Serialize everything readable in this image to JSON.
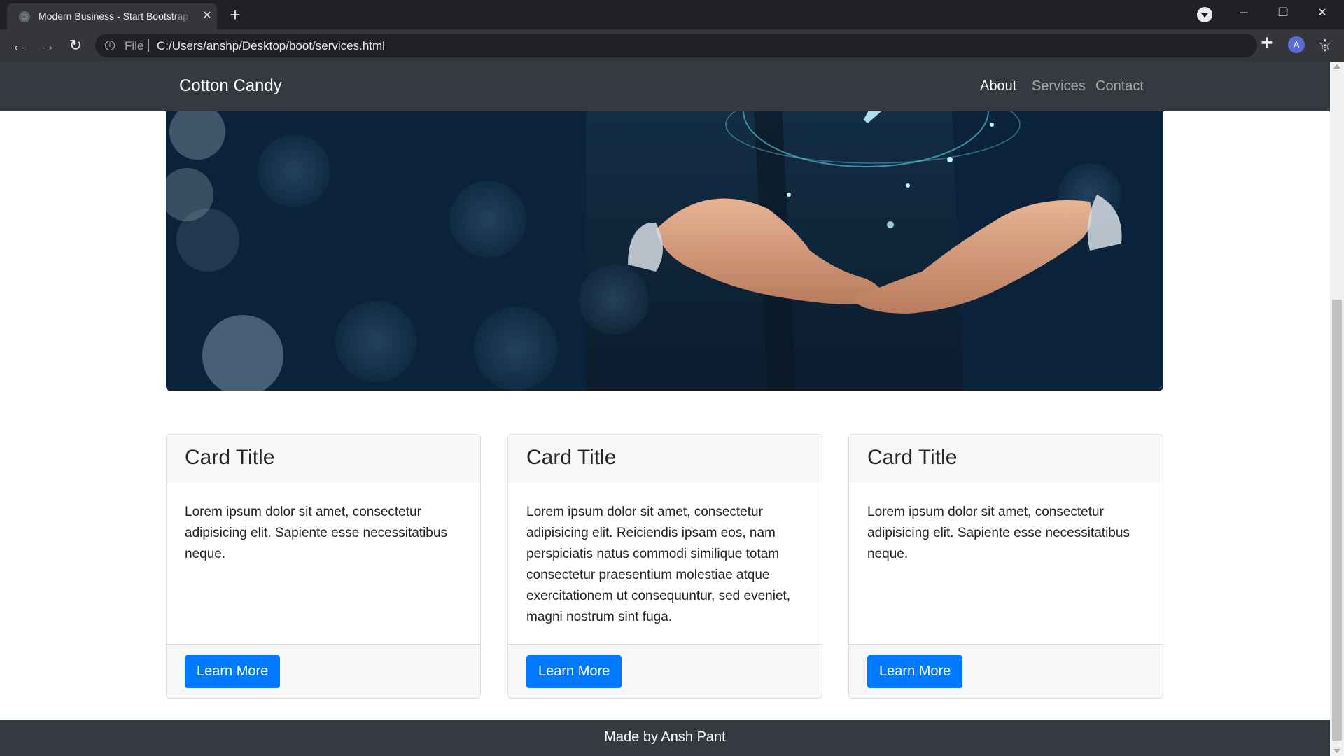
{
  "browser": {
    "tab_title": "Modern Business - Start Bootstrap",
    "tab_close": "✕",
    "new_tab": "+",
    "window_controls": {
      "minimize": "─",
      "maximize": "❐",
      "close": "✕"
    },
    "nav": {
      "back": "←",
      "forward": "→",
      "reload": "↻"
    },
    "url_scheme": "File",
    "url": "C:/Users/anshp/Desktop/boot/services.html",
    "star": "☆",
    "extensions": "✚",
    "profile_initial": "A",
    "menu": "⋮"
  },
  "navbar": {
    "brand": "Cotton Candy",
    "links": [
      {
        "label": "About",
        "active": true
      },
      {
        "label": "Services",
        "active": false
      },
      {
        "label": "Contact",
        "active": false
      }
    ]
  },
  "cards": [
    {
      "title": "Card Title",
      "text": "Lorem ipsum dolor sit amet, consectetur adipisicing elit. Sapiente esse necessitatibus neque.",
      "button": "Learn More"
    },
    {
      "title": "Card Title",
      "text": "Lorem ipsum dolor sit amet, consectetur adipisicing elit. Reiciendis ipsam eos, nam perspiciatis natus commodi similique totam consectetur praesentium molestiae atque exercitationem ut consequuntur, sed eveniet, magni nostrum sint fuga.",
      "button": "Learn More"
    },
    {
      "title": "Card Title",
      "text": "Lorem ipsum dolor sit amet, consectetur adipisicing elit. Sapiente esse necessitatibus neque.",
      "button": "Learn More"
    }
  ],
  "footer": {
    "text": "Made by Ansh Pant"
  },
  "colors": {
    "navbar_bg": "#343a40",
    "primary": "#007bff",
    "card_header_bg": "#f7f7f7",
    "chrome_dark": "#202124",
    "chrome_toolbar": "#35363a"
  }
}
